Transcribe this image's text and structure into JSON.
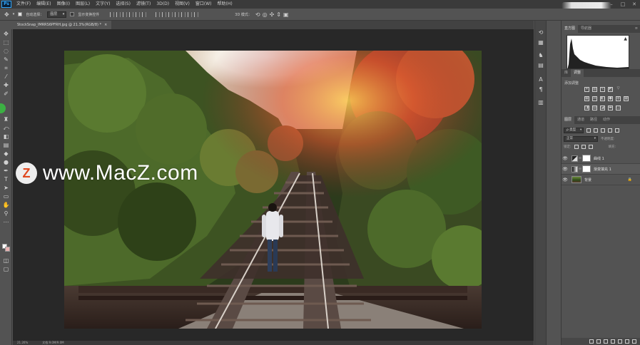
{
  "app": {
    "logo": "Ps"
  },
  "menu": [
    "文件(F)",
    "编辑(E)",
    "图像(I)",
    "图层(L)",
    "文字(Y)",
    "选择(S)",
    "滤镜(T)",
    "3D(D)",
    "视图(V)",
    "窗口(W)",
    "帮助(H)"
  ],
  "options": {
    "auto_select_label": "自动选择：",
    "auto_select_value": "图层",
    "show_transform_label": "显示变换控件",
    "mode_label": "3D 模式："
  },
  "document_tab": {
    "title": "StockSnap_IMRRS6PFRH.jpg @ 21.3%(RGB/8) *",
    "close": "×"
  },
  "watermark": {
    "logo_letter": "Z",
    "text": "www.MacZ.com"
  },
  "status": {
    "zoom": "21.26%",
    "doc": "文档:9.0M/9.0M"
  },
  "panels": {
    "histogram_tabs": [
      "直方图",
      "导航器"
    ],
    "adjust_tabs": [
      "库",
      "调整"
    ],
    "adjust_title": "添加调整",
    "layer_tabs": [
      "图层",
      "通道",
      "路径",
      "动作"
    ],
    "kind_value": "ρ 类型",
    "blend_value": "正常",
    "opacity_label": "不透明度:",
    "lock_label": "锁定:",
    "fill_label": "填充:"
  },
  "layers": [
    {
      "name": "曲线 1",
      "type": "adjustment"
    },
    {
      "name": "渐变填充 1",
      "type": "adjustment"
    },
    {
      "name": "背景",
      "type": "photo",
      "locked": true
    }
  ],
  "colors": {
    "fg": "#ffffff",
    "bg": "#e8b0b0",
    "accent": "#31a8ff",
    "green_ring": "#3cb043"
  }
}
